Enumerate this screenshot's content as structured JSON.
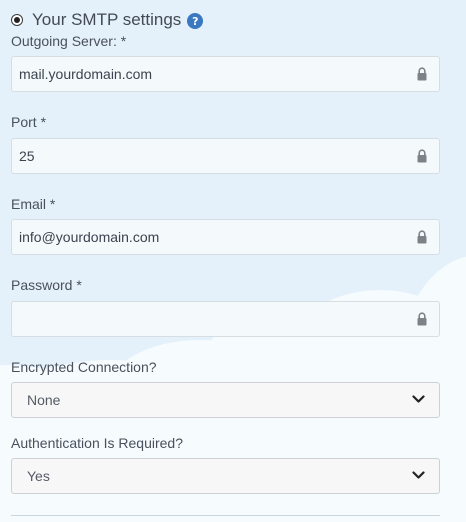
{
  "section": {
    "title": "Your SMTP settings",
    "help_icon": "?"
  },
  "fields": {
    "server": {
      "label": "Outgoing Server: *",
      "value": "mail.yourdomain.com"
    },
    "port": {
      "label": "Port *",
      "value": "25"
    },
    "email": {
      "label": "Email *",
      "value": "info@yourdomain.com"
    },
    "password": {
      "label": "Password *",
      "value": ""
    },
    "encryption": {
      "label": "Encrypted Connection?",
      "selected": "None"
    },
    "auth": {
      "label": "Authentication Is Required?",
      "selected": "Yes"
    }
  },
  "icons": {
    "help": "question-circle-icon",
    "lock": "lock-icon",
    "chevron": "chevron-down-icon"
  },
  "colors": {
    "background": "#e4f1fa",
    "cloud": "#f7fbfe",
    "help_icon": "#3a78c2"
  }
}
